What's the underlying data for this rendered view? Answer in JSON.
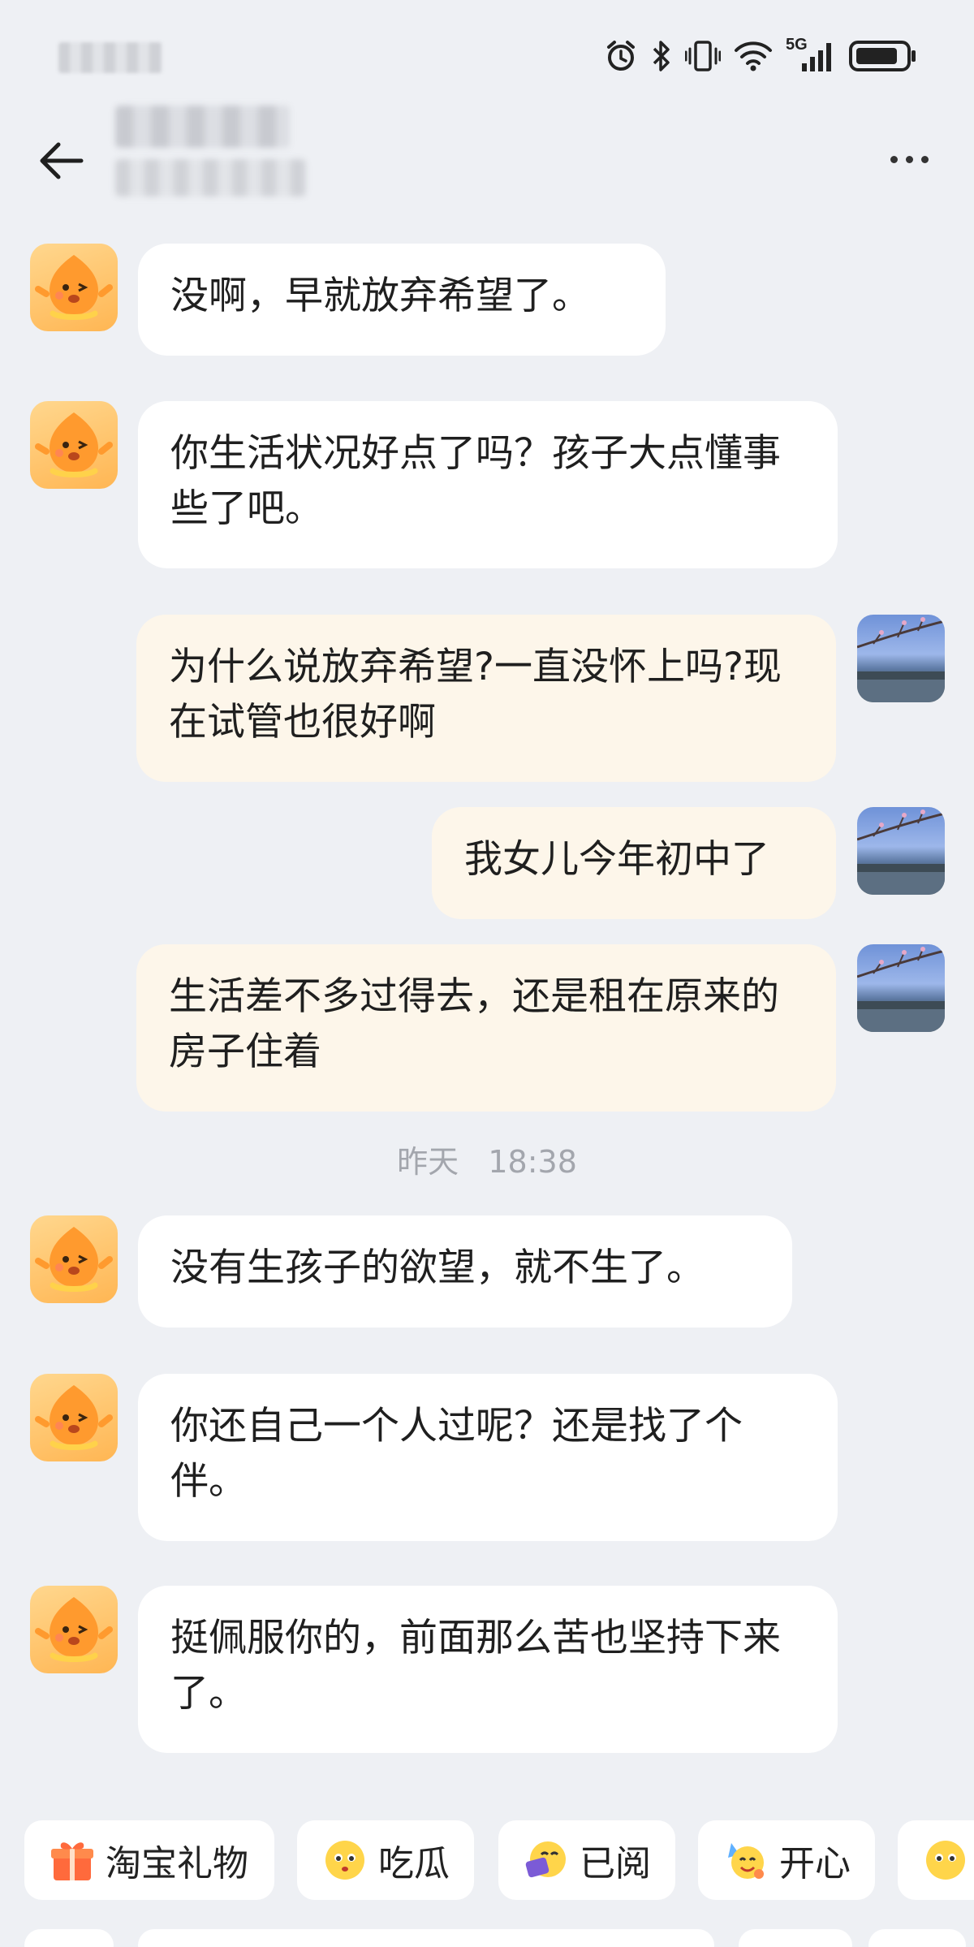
{
  "header": {
    "back_icon": "arrow-left-icon",
    "more_icon": "more-dots-icon"
  },
  "status_bar": {
    "icons": [
      "alarm-icon",
      "bluetooth-icon",
      "vibrate-icon",
      "wifi-icon",
      "signal-5g-icon",
      "battery-icon"
    ],
    "network_label": "5G"
  },
  "messages": [
    {
      "side": "left",
      "text": "没啊，早就放弃希望了。"
    },
    {
      "side": "left",
      "text": "你生活状况好点了吗？孩子大点懂事些了吧。"
    },
    {
      "side": "right",
      "text": "为什么说放弃希望?一直没怀上吗?现在试管也很好啊"
    },
    {
      "side": "right",
      "text": "我女儿今年初中了"
    },
    {
      "side": "right",
      "text": "生活差不多过得去，还是租在原来的房子住着"
    },
    {
      "side": "left",
      "text": "没有生孩子的欲望，就不生了。"
    },
    {
      "side": "left",
      "text": "你还自己一个人过呢？还是找了个伴。"
    },
    {
      "side": "left",
      "text": "挺佩服你的，前面那么苦也坚持下来了。"
    }
  ],
  "timestamp": {
    "day": "昨天",
    "time": "18:38"
  },
  "quick_replies": [
    {
      "label": "淘宝礼物",
      "icon": "gift-icon"
    },
    {
      "label": "吃瓜",
      "icon": "melon-emoji-icon"
    },
    {
      "label": "已阅",
      "icon": "read-emoji-icon"
    },
    {
      "label": "开心",
      "icon": "happy-emoji-icon"
    }
  ],
  "colors": {
    "background": "#eef0f4",
    "incoming_bubble": "#ffffff",
    "outgoing_bubble": "#fdf6ea",
    "timestamp_text": "#a3a6ad",
    "gift_accent": "#ff6a3c"
  }
}
